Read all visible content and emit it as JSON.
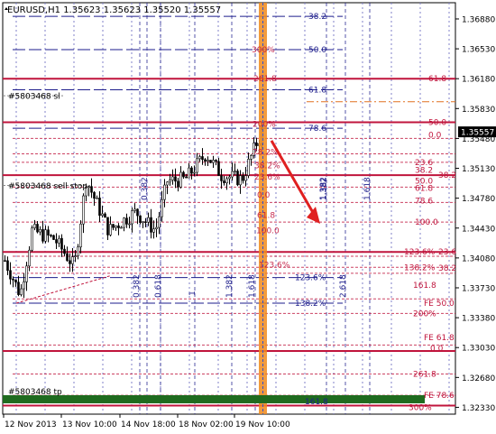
{
  "chart_data": {
    "type": "candlestick",
    "symbol": "EURUSD",
    "timeframe": "H1",
    "header": "EURUSD,H1  1.35623 1.35623 1.35520 1.35557",
    "ohlc": {
      "open": "1.35623",
      "high": "1.35623",
      "low": "1.35520",
      "close": "1.35557"
    },
    "current_price": 1.35557,
    "current_price_label": "1.35557",
    "ylim": [
      1.3225,
      1.3707
    ],
    "y_ticks": [
      "1.36880",
      "1.36530",
      "1.36180",
      "1.35830",
      "1.35480",
      "1.35130",
      "1.34780",
      "1.34430",
      "1.34080",
      "1.33730",
      "1.33380",
      "1.33030",
      "1.32680",
      "1.32330"
    ],
    "x_ticks": [
      "12 Nov 2013",
      "13 Nov 10:00",
      "14 Nov 18:00",
      "18 Nov 02:00",
      "19 Nov 10:00"
    ],
    "orders": [
      {
        "label": "#5803468 sl",
        "price": 1.3598
      },
      {
        "label": "#5803468 sell stop",
        "price": 1.3493
      },
      {
        "label": "#5803468 tp",
        "price": 1.3243
      }
    ],
    "arrow": {
      "from": [
        1.3556
      ],
      "to": [
        1.3448
      ],
      "direction": "down"
    },
    "fib_right_labels": [
      "61.8",
      "50.0",
      "0.0",
      "23.6",
      "38.2",
      "50.0",
      "61.8",
      "78.6",
      "100.0",
      "123.6%",
      "138.2%",
      "161.8",
      "FE 50.0",
      "200%",
      "FE 61.8",
      "0.0",
      "261.8",
      "FE 78.6",
      "300%"
    ],
    "fib_right_dashed_labels": [
      "38.2",
      "23.6",
      "38.2"
    ],
    "fib_center_labels": [
      "38.2",
      "50.0",
      "61.8",
      "78.6",
      "123.6%",
      "138.2%",
      "161.8"
    ],
    "fib_cluster_labels": [
      "300%",
      "261.8",
      "200%",
      "78.2%",
      "38.2%",
      "23.6%",
      "0.0",
      "61.8",
      "100.0",
      "123.6%"
    ],
    "time_zone_labels": [
      "0.382",
      "0.618",
      "1",
      "1.382",
      "1.618",
      "1.382",
      "1.618",
      "2.618",
      "0.382",
      "1.382"
    ],
    "colors": {
      "bull": "#ffffff",
      "bear": "#000000",
      "fib_red": "#c0143c",
      "fib_blue": "#1e1e8c",
      "order_green": "#1f6b1f",
      "time_marker": "#f08a1c",
      "arrow": "#e02020",
      "current_price_bg": "#000000"
    }
  }
}
